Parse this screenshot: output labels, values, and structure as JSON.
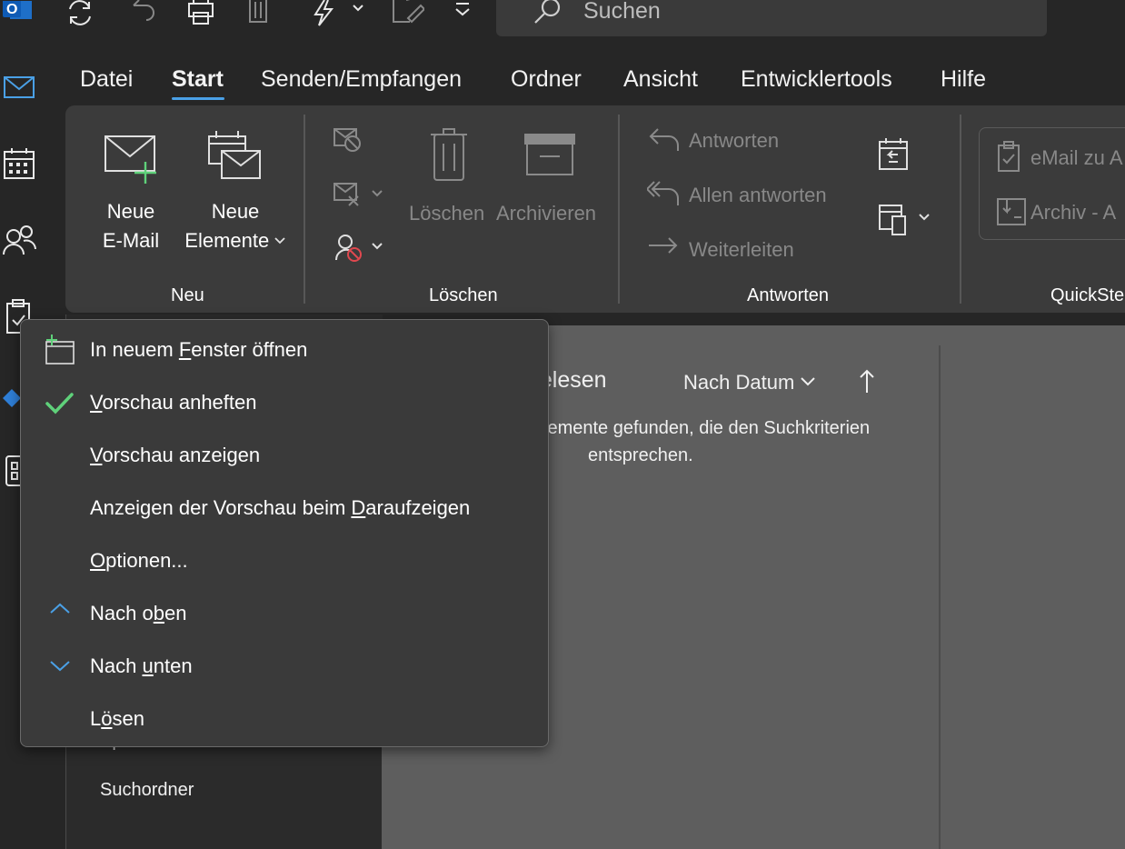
{
  "search": {
    "placeholder": "Suchen"
  },
  "menu": {
    "tabs": [
      "Datei",
      "Start",
      "Senden/Empfangen",
      "Ordner",
      "Ansicht",
      "Entwicklertools",
      "Hilfe"
    ],
    "active_tab": "Start"
  },
  "ribbon": {
    "groups": {
      "neu": {
        "label": "Neu",
        "new_mail": [
          "Neue",
          "E-Mail"
        ],
        "new_items": [
          "Neue",
          "Elemente"
        ]
      },
      "loeschen": {
        "label": "Löschen",
        "delete": "Löschen",
        "archive": "Archivieren"
      },
      "antworten": {
        "label": "Antworten",
        "reply": "Antworten",
        "reply_all": "Allen antworten",
        "forward": "Weiterleiten"
      },
      "quicksteps": {
        "label": "QuickSte",
        "email_to": "eMail zu A",
        "archive_to": "Archiv - A"
      }
    }
  },
  "mail_list": {
    "filter_partial": "gelesen",
    "sort_label": "Nach Datum",
    "empty_line1": "lemente gefunden, die den Suchkriterien",
    "empty_line2": "entsprechen."
  },
  "folders": {
    "partial": "Spam",
    "search_folders": "Suchordner"
  },
  "context_menu": {
    "items": [
      {
        "before": "In neuem ",
        "key": "F",
        "after": "enster öffnen",
        "icon": "new-window-icon"
      },
      {
        "before": "",
        "key": "V",
        "after": "orschau anheften",
        "icon": "checkmark-icon"
      },
      {
        "before": "",
        "key": "V",
        "after": "orschau anzeigen",
        "icon": ""
      },
      {
        "before": "Anzeigen der Vorschau beim ",
        "key": "D",
        "after": "araufzeigen",
        "icon": ""
      },
      {
        "before": "",
        "key": "O",
        "after": "ptionen...",
        "icon": ""
      },
      {
        "before": "Nach o",
        "key": "b",
        "after": "en",
        "icon": "chevron-up-icon"
      },
      {
        "before": "Nach ",
        "key": "u",
        "after": "nten",
        "icon": "chevron-down-icon"
      },
      {
        "before": "L",
        "key": "ö",
        "after": "sen",
        "icon": ""
      }
    ]
  },
  "colors": {
    "accent": "#4aa0e6",
    "check": "#5fd17a",
    "ribbon_bg": "#3b3b3b",
    "menu_bg": "#3a3a3a"
  }
}
